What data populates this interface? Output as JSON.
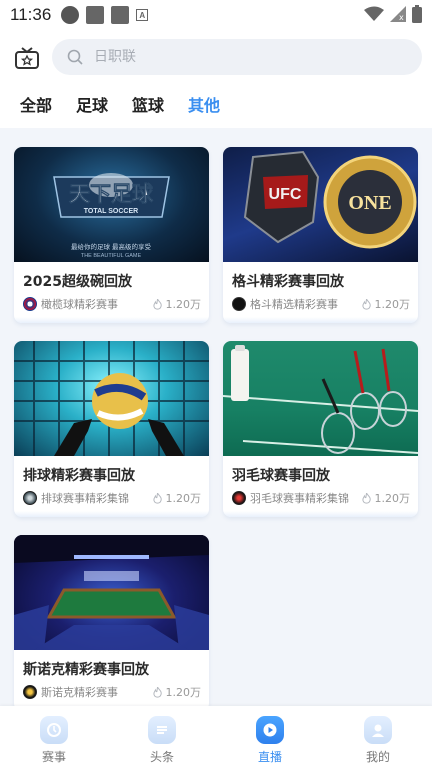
{
  "status_bar": {
    "time": "11:36"
  },
  "search": {
    "placeholder": "日职联"
  },
  "tabs": [
    {
      "label": "全部",
      "active": false
    },
    {
      "label": "足球",
      "active": false
    },
    {
      "label": "篮球",
      "active": false
    },
    {
      "label": "其他",
      "active": true
    }
  ],
  "cards": [
    {
      "title": "2025超级碗回放",
      "source": "橄榄球精彩赛事",
      "views": "1.20万",
      "image_text_main": "天下足球",
      "image_text_sub": "TOTAL SOCCER",
      "image_text_slogan": "最给你的足球 最高级的享受",
      "image_text_slogan2": "THE BEAUTIFUL GAME"
    },
    {
      "title": "格斗精彩赛事回放",
      "source": "格斗精选精彩赛事",
      "views": "1.20万",
      "image_text_main": "UFC",
      "image_text_sub": "ONE"
    },
    {
      "title": "排球精彩赛事回放",
      "source": "排球赛事精彩集锦",
      "views": "1.20万"
    },
    {
      "title": "羽毛球赛事回放",
      "source": "羽毛球赛事精彩集锦",
      "views": "1.20万"
    },
    {
      "title": "斯诺克精彩赛事回放",
      "source": "斯诺克精彩赛事",
      "views": "1.20万"
    }
  ],
  "bottom_nav": [
    {
      "label": "赛事",
      "icon": "schedule-icon",
      "active": false
    },
    {
      "label": "头条",
      "icon": "headline-icon",
      "active": false
    },
    {
      "label": "直播",
      "icon": "live-icon",
      "active": true
    },
    {
      "label": "我的",
      "icon": "profile-icon",
      "active": false
    }
  ],
  "colors": {
    "accent": "#3b8ff0",
    "background": "#f2f5fa"
  }
}
